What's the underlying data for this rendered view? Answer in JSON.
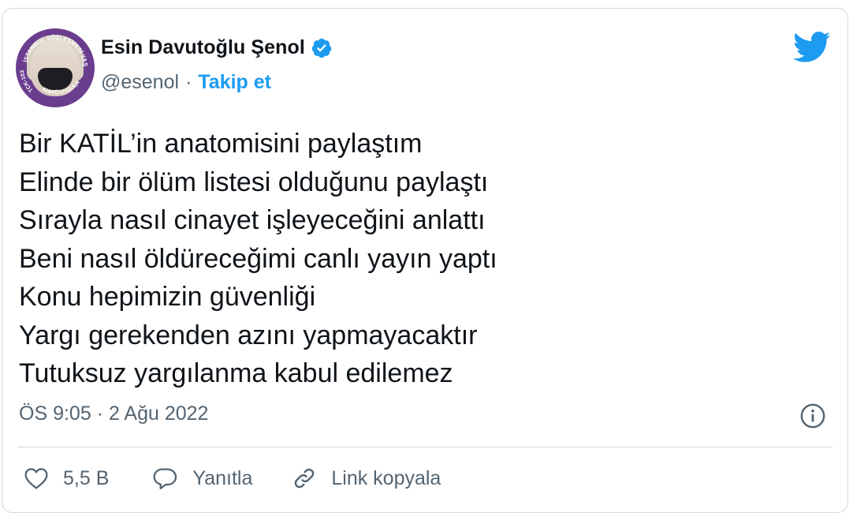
{
  "author": {
    "display_name": "Esin Davutoğlu Şenol",
    "handle": "@esenol",
    "separator": "·",
    "follow_label": "Takip et",
    "avatar_ring_top": "İSTANBUL SÖZLEŞMESİ YAŞATIR",
    "avatar_ring_left": "TCK-103",
    "avatar_ring_bottom": "6284'Ü UYGULA"
  },
  "tweet": {
    "lines": [
      "Bir KATİL’in anatomisini paylaştım",
      "Elinde bir ölüm listesi olduğunu paylaştı",
      "Sırayla nasıl cinayet işleyeceğini anlattı",
      "Beni nasıl öldüreceğimi canlı yayın yaptı",
      "Konu hepimizin güvenliği",
      "Yargı gerekenden azını yapmayacaktır",
      "Tutuksuz yargılanma kabul edilemez"
    ],
    "timestamp": "ÖS 9:05 · 2 Ağu 2022"
  },
  "actions": {
    "like_count": "5,5 B",
    "reply_label": "Yanıtla",
    "copy_link_label": "Link kopyala"
  },
  "colors": {
    "accent": "#1d9bf0",
    "text": "#0f1419",
    "secondary": "#536471",
    "border": "#cfd9de",
    "avatar_ring": "#6a3d8f"
  },
  "icons": [
    "verified-badge-icon",
    "twitter-bird-icon",
    "info-icon",
    "heart-icon",
    "reply-icon",
    "link-icon"
  ]
}
